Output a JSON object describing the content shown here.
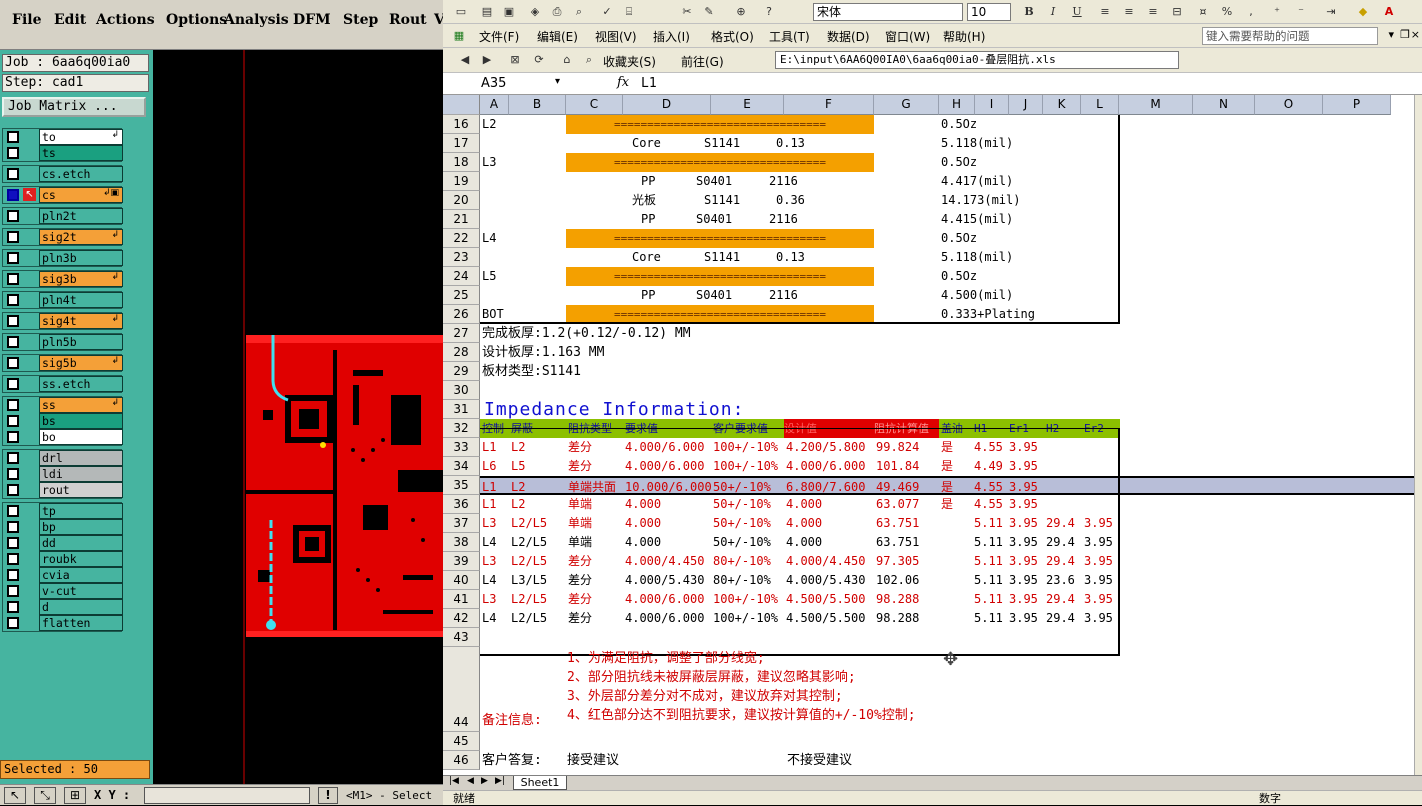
{
  "cam": {
    "menu": [
      "File",
      "Edit",
      "Actions",
      "Options",
      "Analysis",
      "DFM",
      "Step",
      "Rout",
      "V"
    ],
    "job_label": "Job : 6aa6q00ia0",
    "step_label": "Step: cad1",
    "job_matrix_label": "Job Matrix ...",
    "selected_label": "Selected : 50",
    "xy_label": "X Y :",
    "status_msg": "<M1> - Select",
    "groups": [
      [
        {
          "name": "to",
          "color": "#ffffff",
          "mark": "↲"
        },
        {
          "name": "ts",
          "color": "#1aa080",
          "mark": ""
        }
      ],
      [
        {
          "name": "cs.etch",
          "color": "#46b4a0",
          "mark": ""
        }
      ],
      [
        {
          "name": "cs",
          "color": "#f4a038",
          "mark": "↲▣",
          "active": true
        }
      ],
      [
        {
          "name": "pln2t",
          "color": "#46b4a0",
          "mark": ""
        }
      ],
      [
        {
          "name": "sig2t",
          "color": "#f4a038",
          "mark": "↲"
        }
      ],
      [
        {
          "name": "pln3b",
          "color": "#46b4a0",
          "mark": ""
        }
      ],
      [
        {
          "name": "sig3b",
          "color": "#f4a038",
          "mark": "↲"
        }
      ],
      [
        {
          "name": "pln4t",
          "color": "#46b4a0",
          "mark": ""
        }
      ],
      [
        {
          "name": "sig4t",
          "color": "#f4a038",
          "mark": "↲"
        }
      ],
      [
        {
          "name": "pln5b",
          "color": "#46b4a0",
          "mark": ""
        }
      ],
      [
        {
          "name": "sig5b",
          "color": "#f4a038",
          "mark": "↲"
        }
      ],
      [
        {
          "name": "ss.etch",
          "color": "#46b4a0",
          "mark": ""
        }
      ],
      [
        {
          "name": "ss",
          "color": "#f4a038",
          "mark": "↲"
        },
        {
          "name": "bs",
          "color": "#1aa080",
          "mark": ""
        },
        {
          "name": "bo",
          "color": "#ffffff",
          "mark": ""
        }
      ],
      [
        {
          "name": "drl",
          "color": "#b4b8b8",
          "mark": ""
        },
        {
          "name": "ldi",
          "color": "#b4b8b8",
          "mark": ""
        },
        {
          "name": "rout",
          "color": "#d0d0d0",
          "mark": ""
        }
      ],
      [
        {
          "name": "tp",
          "color": "#46b4a0",
          "mark": ""
        },
        {
          "name": "bp",
          "color": "#46b4a0",
          "mark": ""
        },
        {
          "name": "dd",
          "color": "#46b4a0",
          "mark": ""
        },
        {
          "name": "roubk",
          "color": "#46b4a0",
          "mark": ""
        },
        {
          "name": "cvia",
          "color": "#46b4a0",
          "mark": ""
        },
        {
          "name": "v-cut",
          "color": "#46b4a0",
          "mark": ""
        },
        {
          "name": "d",
          "color": "#46b4a0",
          "mark": ""
        },
        {
          "name": "flatten",
          "color": "#46b4a0",
          "mark": ""
        }
      ]
    ]
  },
  "excel": {
    "font_name": "宋体",
    "font_size": "10",
    "menu": [
      "文件(F)",
      "编辑(E)",
      "视图(V)",
      "插入(I)",
      "格式(O)",
      "工具(T)",
      "数据(D)",
      "窗口(W)",
      "帮助(H)"
    ],
    "help_placeholder": "键入需要帮助的问题",
    "favorites_label": "收藏夹(S)",
    "goto_label": "前往(G)",
    "address_path": "E:\\input\\6AA6Q00IA0\\6aa6q00ia0-叠层阻抗.xls",
    "name_box": "A35",
    "fx": "fx",
    "formula_value": "L1",
    "columns": [
      "A",
      "B",
      "C",
      "D",
      "E",
      "F",
      "G",
      "H",
      "I",
      "J",
      "K",
      "L",
      "M",
      "N",
      "O",
      "P"
    ],
    "sheet_tab": "Sheet1",
    "status_left": "就绪",
    "status_right": "数字",
    "rows": [
      {
        "n": "16",
        "cells": [
          {
            "c": "A",
            "t": "L2"
          },
          {
            "c": "bar",
            "t": "================================"
          },
          {
            "c": "H",
            "t": "0.5Oz"
          }
        ]
      },
      {
        "n": "17",
        "cells": [
          {
            "c": "D2",
            "t": "Core"
          },
          {
            "c": "E2",
            "t": "S1141"
          },
          {
            "c": "F2",
            "t": "0.13"
          },
          {
            "c": "H",
            "t": "5.118(mil)"
          }
        ]
      },
      {
        "n": "18",
        "cells": [
          {
            "c": "A",
            "t": "L3"
          },
          {
            "c": "bar",
            "t": "================================"
          },
          {
            "c": "H",
            "t": "0.5Oz"
          }
        ]
      },
      {
        "n": "19",
        "cells": [
          {
            "c": "D3",
            "t": "PP"
          },
          {
            "c": "E3",
            "t": "S0401"
          },
          {
            "c": "F3",
            "t": "2116"
          },
          {
            "c": "H",
            "t": "4.417(mil)"
          }
        ]
      },
      {
        "n": "20",
        "cells": [
          {
            "c": "D4",
            "t": "光板"
          },
          {
            "c": "E2",
            "t": "S1141"
          },
          {
            "c": "F2",
            "t": "0.36"
          },
          {
            "c": "H",
            "t": "14.173(mil)"
          }
        ]
      },
      {
        "n": "21",
        "cells": [
          {
            "c": "D3",
            "t": "PP"
          },
          {
            "c": "E3",
            "t": "S0401"
          },
          {
            "c": "F3",
            "t": "2116"
          },
          {
            "c": "H",
            "t": "4.415(mil)"
          }
        ]
      },
      {
        "n": "22",
        "cells": [
          {
            "c": "A",
            "t": "L4"
          },
          {
            "c": "bar",
            "t": "================================"
          },
          {
            "c": "H",
            "t": "0.5Oz"
          }
        ]
      },
      {
        "n": "23",
        "cells": [
          {
            "c": "D2",
            "t": "Core"
          },
          {
            "c": "E2",
            "t": "S1141"
          },
          {
            "c": "F2",
            "t": "0.13"
          },
          {
            "c": "H",
            "t": "5.118(mil)"
          }
        ]
      },
      {
        "n": "24",
        "cells": [
          {
            "c": "A",
            "t": "L5"
          },
          {
            "c": "bar",
            "t": "================================"
          },
          {
            "c": "H",
            "t": "0.5Oz"
          }
        ]
      },
      {
        "n": "25",
        "cells": [
          {
            "c": "D3",
            "t": "PP"
          },
          {
            "c": "E3",
            "t": "S0401"
          },
          {
            "c": "F3",
            "t": "2116"
          },
          {
            "c": "H",
            "t": "4.500(mil)"
          }
        ]
      },
      {
        "n": "26",
        "cells": [
          {
            "c": "A",
            "t": "BOT"
          },
          {
            "c": "bar",
            "t": "================================"
          },
          {
            "c": "H",
            "t": "0.333+Plating"
          }
        ]
      },
      {
        "n": "27",
        "cells": [
          {
            "c": "A",
            "t": "完成板厚:1.2(+0.12/-0.12) MM"
          }
        ]
      },
      {
        "n": "28",
        "cells": [
          {
            "c": "A",
            "t": "设计板厚:1.163 MM"
          }
        ]
      },
      {
        "n": "29",
        "cells": [
          {
            "c": "A",
            "t": "板材类型:S1141"
          }
        ]
      },
      {
        "n": "30",
        "cells": []
      },
      {
        "n": "31",
        "cells": [
          {
            "c": "TITLE",
            "t": "Impedance Information:"
          }
        ]
      },
      {
        "n": "32",
        "cells": [
          {
            "c": "A",
            "t": "控制"
          },
          {
            "c": "B",
            "t": "屏蔽"
          },
          {
            "c": "C",
            "t": "阻抗类型"
          },
          {
            "c": "D",
            "t": "要求值"
          },
          {
            "c": "E",
            "t": "客户要求值"
          },
          {
            "c": "F",
            "t": "设计值"
          },
          {
            "c": "G",
            "t": "阻抗计算值"
          },
          {
            "c": "H",
            "t": "盖油"
          },
          {
            "c": "I",
            "t": "H1"
          },
          {
            "c": "J",
            "t": "Er1"
          },
          {
            "c": "K",
            "t": "H2"
          },
          {
            "c": "L",
            "t": "Er2"
          }
        ]
      },
      {
        "n": "33",
        "cells": [
          {
            "c": "A",
            "t": "L1"
          },
          {
            "c": "B",
            "t": "L2"
          },
          {
            "c": "C",
            "t": "差分"
          },
          {
            "c": "D",
            "t": "4.000/6.000"
          },
          {
            "c": "E",
            "t": "100+/-10%"
          },
          {
            "c": "F",
            "t": "4.200/5.800"
          },
          {
            "c": "G",
            "t": "99.824"
          },
          {
            "c": "H",
            "t": "是"
          },
          {
            "c": "I",
            "t": "4.55"
          },
          {
            "c": "J",
            "t": "3.95"
          },
          {
            "c": "K",
            "t": ""
          },
          {
            "c": "L",
            "t": ""
          }
        ]
      },
      {
        "n": "34",
        "cells": [
          {
            "c": "A",
            "t": "L6"
          },
          {
            "c": "B",
            "t": "L5"
          },
          {
            "c": "C",
            "t": "差分"
          },
          {
            "c": "D",
            "t": "4.000/6.000"
          },
          {
            "c": "E",
            "t": "100+/-10%"
          },
          {
            "c": "F",
            "t": "4.000/6.000"
          },
          {
            "c": "G",
            "t": "101.84"
          },
          {
            "c": "H",
            "t": "是"
          },
          {
            "c": "I",
            "t": "4.49"
          },
          {
            "c": "J",
            "t": "3.95"
          },
          {
            "c": "K",
            "t": ""
          },
          {
            "c": "L",
            "t": ""
          }
        ]
      },
      {
        "n": "35",
        "cells": [
          {
            "c": "A",
            "t": "L1"
          },
          {
            "c": "B",
            "t": "L2"
          },
          {
            "c": "C",
            "t": "单端共面"
          },
          {
            "c": "D",
            "t": "10.000/6.000"
          },
          {
            "c": "E",
            "t": "50+/-10%"
          },
          {
            "c": "F",
            "t": "6.800/7.600"
          },
          {
            "c": "G",
            "t": "49.469"
          },
          {
            "c": "H",
            "t": "是"
          },
          {
            "c": "I",
            "t": "4.55"
          },
          {
            "c": "J",
            "t": "3.95"
          },
          {
            "c": "K",
            "t": ""
          },
          {
            "c": "L",
            "t": ""
          }
        ]
      },
      {
        "n": "36",
        "cells": [
          {
            "c": "A",
            "t": "L1"
          },
          {
            "c": "B",
            "t": "L2"
          },
          {
            "c": "C",
            "t": "单端"
          },
          {
            "c": "D",
            "t": "4.000"
          },
          {
            "c": "E",
            "t": "50+/-10%"
          },
          {
            "c": "F",
            "t": "4.000"
          },
          {
            "c": "G",
            "t": "63.077"
          },
          {
            "c": "H",
            "t": "是"
          },
          {
            "c": "I",
            "t": "4.55"
          },
          {
            "c": "J",
            "t": "3.95"
          },
          {
            "c": "K",
            "t": ""
          },
          {
            "c": "L",
            "t": ""
          }
        ]
      },
      {
        "n": "37",
        "cells": [
          {
            "c": "A",
            "t": "L3"
          },
          {
            "c": "B",
            "t": "L2/L5"
          },
          {
            "c": "C",
            "t": "单端"
          },
          {
            "c": "D",
            "t": "4.000"
          },
          {
            "c": "E",
            "t": "50+/-10%"
          },
          {
            "c": "F",
            "t": "4.000"
          },
          {
            "c": "G",
            "t": "63.751"
          },
          {
            "c": "H",
            "t": ""
          },
          {
            "c": "I",
            "t": "5.11"
          },
          {
            "c": "J",
            "t": "3.95"
          },
          {
            "c": "K",
            "t": "29.4"
          },
          {
            "c": "L",
            "t": "3.95"
          }
        ]
      },
      {
        "n": "38",
        "cells": [
          {
            "c": "A",
            "t": "L4"
          },
          {
            "c": "B",
            "t": "L2/L5"
          },
          {
            "c": "C",
            "t": "单端"
          },
          {
            "c": "D",
            "t": "4.000"
          },
          {
            "c": "E",
            "t": "50+/-10%"
          },
          {
            "c": "F",
            "t": "4.000"
          },
          {
            "c": "G",
            "t": "63.751"
          },
          {
            "c": "H",
            "t": ""
          },
          {
            "c": "I",
            "t": "5.11"
          },
          {
            "c": "J",
            "t": "3.95"
          },
          {
            "c": "K",
            "t": "29.4"
          },
          {
            "c": "L",
            "t": "3.95"
          }
        ]
      },
      {
        "n": "39",
        "cells": [
          {
            "c": "A",
            "t": "L3"
          },
          {
            "c": "B",
            "t": "L2/L5"
          },
          {
            "c": "C",
            "t": "差分"
          },
          {
            "c": "D",
            "t": "4.000/4.450"
          },
          {
            "c": "E",
            "t": "80+/-10%"
          },
          {
            "c": "F",
            "t": "4.000/4.450"
          },
          {
            "c": "G",
            "t": "97.305"
          },
          {
            "c": "H",
            "t": ""
          },
          {
            "c": "I",
            "t": "5.11"
          },
          {
            "c": "J",
            "t": "3.95"
          },
          {
            "c": "K",
            "t": "29.4"
          },
          {
            "c": "L",
            "t": "3.95"
          }
        ]
      },
      {
        "n": "40",
        "cells": [
          {
            "c": "A",
            "t": "L4"
          },
          {
            "c": "B",
            "t": "L3/L5"
          },
          {
            "c": "C",
            "t": "差分"
          },
          {
            "c": "D",
            "t": "4.000/5.430"
          },
          {
            "c": "E",
            "t": "80+/-10%"
          },
          {
            "c": "F",
            "t": "4.000/5.430"
          },
          {
            "c": "G",
            "t": "102.06"
          },
          {
            "c": "H",
            "t": ""
          },
          {
            "c": "I",
            "t": "5.11"
          },
          {
            "c": "J",
            "t": "3.95"
          },
          {
            "c": "K",
            "t": "23.6"
          },
          {
            "c": "L",
            "t": "3.95"
          }
        ]
      },
      {
        "n": "41",
        "cells": [
          {
            "c": "A",
            "t": "L3"
          },
          {
            "c": "B",
            "t": "L2/L5"
          },
          {
            "c": "C",
            "t": "差分"
          },
          {
            "c": "D",
            "t": "4.000/6.000"
          },
          {
            "c": "E",
            "t": "100+/-10%"
          },
          {
            "c": "F",
            "t": "4.500/5.500"
          },
          {
            "c": "G",
            "t": "98.288"
          },
          {
            "c": "H",
            "t": ""
          },
          {
            "c": "I",
            "t": "5.11"
          },
          {
            "c": "J",
            "t": "3.95"
          },
          {
            "c": "K",
            "t": "29.4"
          },
          {
            "c": "L",
            "t": "3.95"
          }
        ]
      },
      {
        "n": "42",
        "cells": [
          {
            "c": "A",
            "t": "L4"
          },
          {
            "c": "B",
            "t": "L2/L5"
          },
          {
            "c": "C",
            "t": "差分"
          },
          {
            "c": "D",
            "t": "4.000/6.000"
          },
          {
            "c": "E",
            "t": "100+/-10%"
          },
          {
            "c": "F",
            "t": "4.500/5.500"
          },
          {
            "c": "G",
            "t": "98.288"
          },
          {
            "c": "H",
            "t": ""
          },
          {
            "c": "I",
            "t": "5.11"
          },
          {
            "c": "J",
            "t": "3.95"
          },
          {
            "c": "K",
            "t": "29.4"
          },
          {
            "c": "L",
            "t": "3.95"
          }
        ]
      },
      {
        "n": "43",
        "cells": []
      }
    ],
    "red_rows": [
      "33",
      "34",
      "35",
      "36",
      "37",
      "39",
      "41"
    ],
    "remarks_label": "备注信息:",
    "remarks": [
      "1、为满足阻抗，调整了部分线宽;",
      "2、部分阻抗线未被屏蔽层屏蔽，建议忽略其影响;",
      "3、外层部分差分对不成对，建议放弃对其控制;",
      "4、红色部分达不到阻抗要求，建议按计算值的+/-10%控制;"
    ],
    "row44": "44",
    "row45": "45",
    "row46": "46",
    "customer_reply_label": "客户答复:",
    "accept_label": "接受建议",
    "reject_label": "不接受建议"
  }
}
